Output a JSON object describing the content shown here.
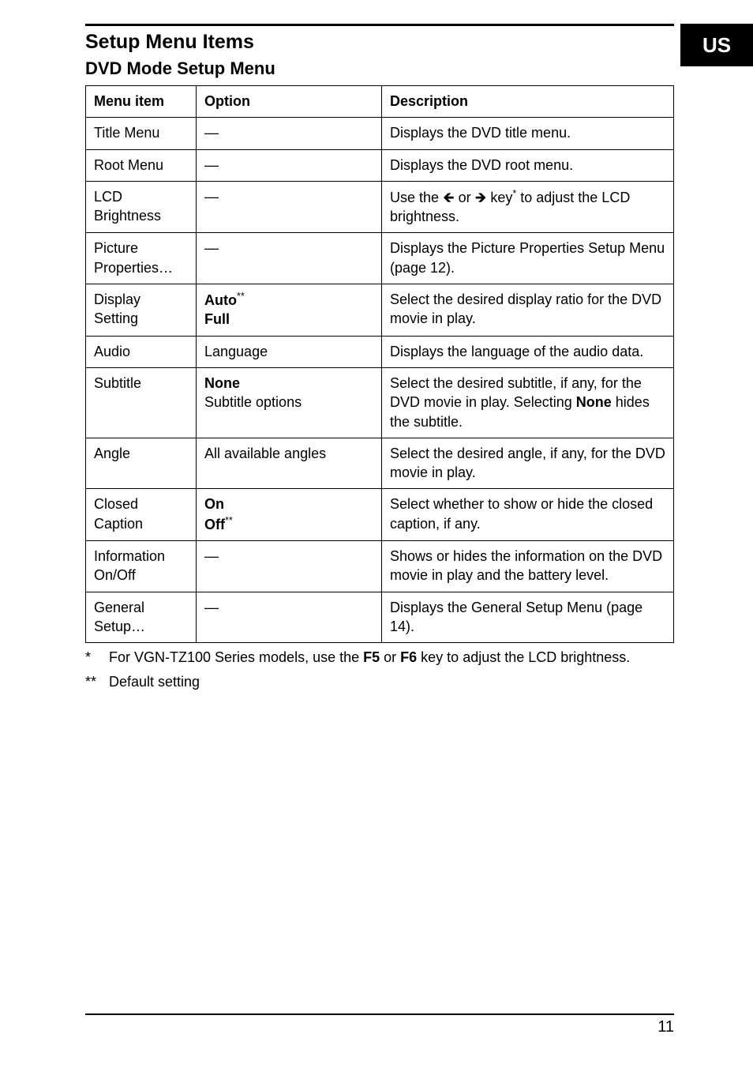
{
  "region_tab": "US",
  "section_title": "Setup Menu Items",
  "sub_title": "DVD Mode Setup Menu",
  "table": {
    "headers": [
      "Menu item",
      "Option",
      "Description"
    ],
    "rows": [
      {
        "item": "Title Menu",
        "option": "—",
        "desc": "Displays the DVD title menu."
      },
      {
        "item": "Root Menu",
        "option": "—",
        "desc": "Displays the DVD root menu."
      },
      {
        "item": "LCD Brightness",
        "option": "—",
        "desc_pre": "Use the ",
        "desc_mid": " key",
        "desc_sup": "*",
        "desc_post": " to adjust the LCD brightness."
      },
      {
        "item": "Picture Properties…",
        "option": "—",
        "desc": "Displays the Picture Properties Setup Menu (page 12)."
      },
      {
        "item": "Display Setting",
        "option_bold1": "Auto",
        "option_sup": "**",
        "option_bold2": "Full",
        "desc": "Select the desired display ratio for the DVD movie in play."
      },
      {
        "item": "Audio",
        "option": "Language",
        "desc": "Displays the language of the audio data."
      },
      {
        "item": "Subtitle",
        "option_bold1": "None",
        "option_plain": "Subtitle options",
        "desc_pre2": "Select the desired subtitle, if any, for the DVD movie in play. Selecting ",
        "desc_bold": "None",
        "desc_post2": " hides the subtitle."
      },
      {
        "item": "Angle",
        "option": "All available angles",
        "desc": "Select the desired angle, if any, for the DVD movie in play."
      },
      {
        "item": "Closed Caption",
        "option_bold1": "On",
        "option_bold2": "Off",
        "option_sup2": "**",
        "desc": "Select whether to show or hide the closed caption, if any."
      },
      {
        "item": "Information On/Off",
        "option": "—",
        "desc": "Shows or hides the information on the DVD movie in play and the battery level."
      },
      {
        "item": "General Setup…",
        "option": "—",
        "desc": "Displays the General Setup Menu (page 14)."
      }
    ]
  },
  "footnotes": {
    "f1_mark": "*",
    "f1_pre": "For VGN-TZ100 Series models, use the ",
    "f1_b1": "F5",
    "f1_mid": " or ",
    "f1_b2": "F6",
    "f1_post": " key to adjust the LCD brightness.",
    "f2_mark": "**",
    "f2_text": "Default setting"
  },
  "page_number": "11"
}
